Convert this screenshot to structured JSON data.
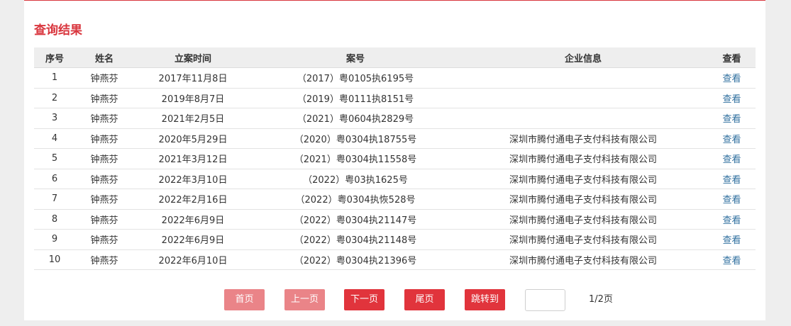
{
  "title": "查询结果",
  "table": {
    "headers": [
      "序号",
      "姓名",
      "立案时间",
      "案号",
      "企业信息",
      "查看"
    ],
    "rows": [
      [
        "1",
        "钟燕芬",
        "2017年11月8日",
        "（2017）粤0105执6195号",
        "",
        "查看"
      ],
      [
        "2",
        "钟燕芬",
        "2019年8月7日",
        "（2019）粤0111执8151号",
        "",
        "查看"
      ],
      [
        "3",
        "钟燕芬",
        "2021年2月5日",
        "（2021）粤0604执2829号",
        "",
        "查看"
      ],
      [
        "4",
        "钟燕芬",
        "2020年5月29日",
        "（2020）粤0304执18755号",
        "深圳市腾付通电子支付科技有限公司",
        "查看"
      ],
      [
        "5",
        "钟燕芬",
        "2021年3月12日",
        "（2021）粤0304执11558号",
        "深圳市腾付通电子支付科技有限公司",
        "查看"
      ],
      [
        "6",
        "钟燕芬",
        "2022年3月10日",
        "（2022）粤03执1625号",
        "深圳市腾付通电子支付科技有限公司",
        "查看"
      ],
      [
        "7",
        "钟燕芬",
        "2022年2月16日",
        "（2022）粤0304执恢528号",
        "深圳市腾付通电子支付科技有限公司",
        "查看"
      ],
      [
        "8",
        "钟燕芬",
        "2022年6月9日",
        "（2022）粤0304执21147号",
        "深圳市腾付通电子支付科技有限公司",
        "查看"
      ],
      [
        "9",
        "钟燕芬",
        "2022年6月9日",
        "（2022）粤0304执21148号",
        "深圳市腾付通电子支付科技有限公司",
        "查看"
      ],
      [
        "10",
        "钟燕芬",
        "2022年6月10日",
        "（2022）粤0304执21396号",
        "深圳市腾付通电子支付科技有限公司",
        "查看"
      ]
    ]
  },
  "pager": {
    "first": "首页",
    "prev": "上一页",
    "next": "下一页",
    "last": "尾页",
    "jump": "跳转到",
    "page_input": "",
    "page_info": "1/2页"
  },
  "colors": {
    "accent": "#d9363e",
    "button_active": "#e1343c",
    "button_disabled": "#ea8488",
    "link": "#2f6f9f"
  }
}
